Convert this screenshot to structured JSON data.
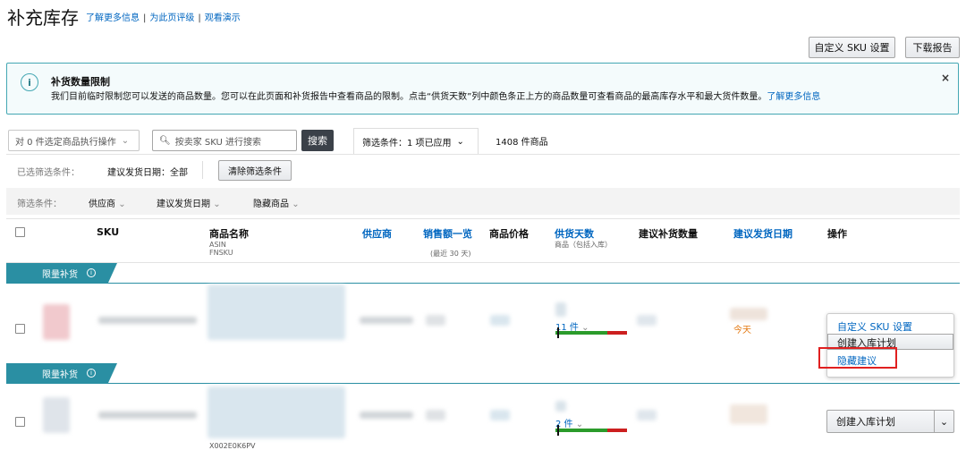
{
  "page": {
    "title": "补充库存",
    "links": [
      "了解更多信息",
      "为此页评级",
      "观看演示"
    ]
  },
  "top_buttons": {
    "custom_sku": "自定义 SKU 设置",
    "download": "下载报告"
  },
  "alert": {
    "icon": "i",
    "title": "补货数量限制",
    "body": "我们目前临时限制您可以发送的商品数量。您可以在此页面和补货报告中查看商品的限制。点击“供货天数”列中颜色条正上方的商品数量可查看商品的最高库存水平和最大货件数量。",
    "link": "了解更多信息",
    "close": "×"
  },
  "toolbar": {
    "bulk_action": "对 0 件选定商品执行操作",
    "search_placeholder": "按卖家 SKU 进行搜索",
    "search_button": "搜索",
    "filter_applied": "筛选条件：1 项已应用",
    "item_count": "1408 件商品"
  },
  "selected_filters": {
    "label": "已选筛选条件：",
    "value": "建议发货日期：全部",
    "clear_button": "清除筛选条件"
  },
  "filters": {
    "label": "筛选条件：",
    "items": [
      "供应商",
      "建议发货日期",
      "隐藏商品"
    ]
  },
  "table": {
    "headers": {
      "sku": "SKU",
      "product_name": "商品名称",
      "asin": "ASIN",
      "fnsku": "FNSKU",
      "supplier": "供应商",
      "sales": "销售额一览",
      "sales_sub": "(最近 30 天)",
      "price": "商品价格",
      "days_of_supply": "供货天数",
      "days_sub": "商品（包括入库）",
      "suggested_qty": "建议补货数量",
      "ship_date": "建议发货日期",
      "action": "操作"
    },
    "badge_label": "限量补货",
    "rows": [
      {
        "supply_units": "11 件",
        "ship_date": "今天"
      },
      {
        "supply_units": "2 件",
        "fnsku_partial": "X002E0K6PV"
      }
    ]
  },
  "action_menu": {
    "items": [
      "自定义 SKU 设置",
      "创建入库计划",
      "隐藏建议"
    ]
  },
  "row2_action": {
    "label": "创建入库计划"
  },
  "colors": {
    "accent": "#0066c0",
    "alert_border": "#44a7b3",
    "badge": "#2a8fa3",
    "bar_green": "#2b9b2b",
    "bar_red": "#cc1f1f",
    "highlight": "#e02020"
  }
}
